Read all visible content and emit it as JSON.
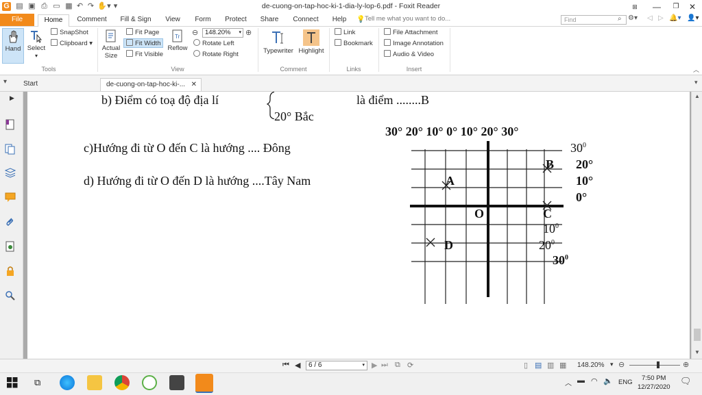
{
  "window": {
    "title": "de-cuong-on-tap-hoc-ki-1-dia-ly-lop-6.pdf - Foxit Reader"
  },
  "menu": {
    "tabs": [
      "File",
      "Home",
      "Comment",
      "Fill & Sign",
      "View",
      "Form",
      "Protect",
      "Share",
      "Connect",
      "Help"
    ],
    "tell_me": "Tell me what you want to do...",
    "search_placeholder": "Find"
  },
  "ribbon": {
    "tools": {
      "label": "Tools",
      "hand": "Hand",
      "select": "Select",
      "snapshot": "SnapShot",
      "clipboard": "Clipboard"
    },
    "view": {
      "label": "View",
      "actual_size_1": "Actual",
      "actual_size_2": "Size",
      "fit_page": "Fit Page",
      "fit_width": "Fit Width",
      "fit_visible": "Fit Visible",
      "reflow": "Reflow",
      "zoom": "148.20%",
      "rotate_left": "Rotate Left",
      "rotate_right": "Rotate Right"
    },
    "comment": {
      "label": "Comment",
      "typewriter": "Typewriter",
      "highlight": "Highlight"
    },
    "links": {
      "label": "Links",
      "link": "Link",
      "bookmark": "Bookmark"
    },
    "insert": {
      "label": "Insert",
      "file_attachment": "File Attachment",
      "image_annotation": "Image Annotation",
      "audio_video": "Audio & Video"
    }
  },
  "doc_tabs": {
    "start": "Start",
    "active": "de-cuong-on-tap-hoc-ki-..."
  },
  "document": {
    "line_b": "b)  Điểm có toạ độ địa lí",
    "line_b_answer": "là điểm ........B",
    "line_b_sub": "20° Bắc",
    "line_c": "c)Hướng đi từ O đến C là hướng ....  Đông",
    "line_d": "d) Hướng đi từ O đến D là hướng ....Tây Nam",
    "grid": {
      "top_scale": "30° 20° 10° 0° 10° 20° 30°",
      "right_labels": [
        "30",
        "20°",
        "10°",
        "0°"
      ],
      "bottom_labels": [
        "10",
        "20",
        "30"
      ],
      "sup": "0",
      "points": {
        "A": "A",
        "B": "B",
        "C": "C",
        "D": "D",
        "O": "O"
      }
    }
  },
  "status": {
    "page": "6 / 6",
    "zoom": "148.20%"
  },
  "taskbar": {
    "lang": "ENG",
    "time": "7:50 PM",
    "date": "12/27/2020"
  },
  "colors": {
    "accent": "#f28a1b",
    "ribbon_selected": "#cde4f7",
    "doc_bg": "#ababab"
  }
}
